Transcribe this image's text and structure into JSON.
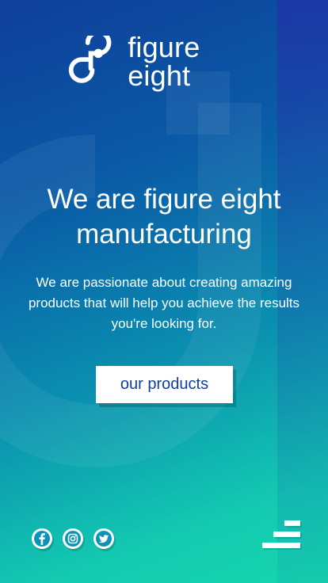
{
  "brand": {
    "name": "figure eight"
  },
  "hero": {
    "title": "We are figure eight manufacturing",
    "subtitle": "We are passionate about creating amazing products that will help you achieve the results you're looking for."
  },
  "cta": {
    "label": "our products"
  },
  "social": [
    "facebook-icon",
    "instagram-icon",
    "twitter-icon"
  ],
  "colors": {
    "accent": "#0f3fa0",
    "gradient_top": "#0f3f9a",
    "gradient_bottom": "#16d6ad"
  }
}
